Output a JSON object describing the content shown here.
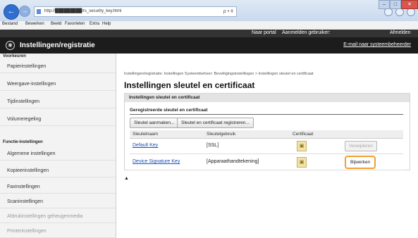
{
  "browser": {
    "url": "http://█████████/rs_security_key.html",
    "search_hint": "ρ • ¢",
    "menu": [
      "Bestand",
      "Bewerken",
      "Beeld",
      "Favorieten",
      "Extra",
      "Help"
    ]
  },
  "header": {
    "portal_link": "Naar portal",
    "login_label": "Aanmelden gebruiker:",
    "logout_link": "Afmelden",
    "app_title": "Instellingen/registratie",
    "admin_mail": "E-mail naar systeembeheerder"
  },
  "sidebar": {
    "group1": "Voorkeuren",
    "items1": [
      "Papierinstellingen",
      "Weergave-instellingen",
      "Tijdinstellingen",
      "Volumeregeling"
    ],
    "group2": "Functie-instellingen",
    "items2": [
      "Algemene instellingen",
      "Kopieerinstellingen",
      "Faxinstellingen",
      "Scaninstellingen",
      "Afdrukinstellingen geheugenmedia",
      "Printerinstellingen"
    ]
  },
  "main": {
    "breadcrumb": "Instellingen/registratie: Instellingen Systeembeheer: Beveiligingsinstellingen > Instellingen sleutel en certificaat",
    "title": "Instellingen sleutel en certificaat",
    "panel_title": "Instellingen sleutel en certificaat",
    "section": "Geregistreerde sleutel en certificaat",
    "btn_create": "Sleutel aanmaken...",
    "btn_register": "Sleutel en certificaat registreren...",
    "columns": [
      "Sleutelnaam",
      "Sleutelgebruik",
      "Certificaat"
    ],
    "rows": [
      {
        "name": "Default Key",
        "usage": "[SSL]",
        "action": "Verwijderen"
      },
      {
        "name": "Device Signature Key",
        "usage": "[Apparaathandtekening]",
        "action": "Bijwerken"
      }
    ]
  }
}
